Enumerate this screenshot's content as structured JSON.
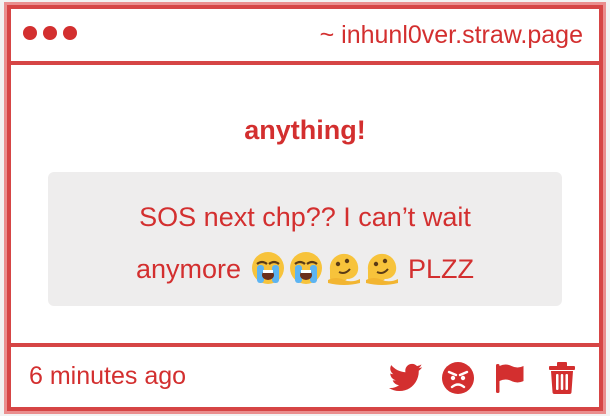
{
  "window": {
    "site_url": "~ inhunl0ver.straw.page"
  },
  "post": {
    "heading": "anything!",
    "message_line1": "SOS next chp?? I can’t wait",
    "message_line2_text": "anymore",
    "message_line2_suffix": "PLZZ",
    "emojis": [
      "loudly-crying-face",
      "loudly-crying-face",
      "melting-face",
      "melting-face"
    ]
  },
  "footer": {
    "timestamp": "6 minutes ago",
    "actions": [
      "twitter-icon",
      "angry-face-icon",
      "flag-icon",
      "trash-icon"
    ]
  },
  "colors": {
    "accent": "#d32f2f",
    "border": "#d64545",
    "message_bg": "#eeeded"
  }
}
